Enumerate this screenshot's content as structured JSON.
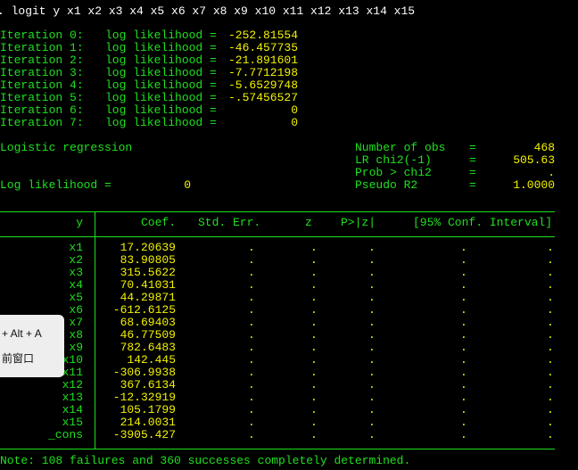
{
  "command": ". logit y x1 x2 x3 x4 x5 x6 x7 x8 x9 x10 x11 x12 x13 x14 x15",
  "iterations": [
    {
      "label": "Iteration 0:",
      "text": "log likelihood =",
      "value": "-252.81554"
    },
    {
      "label": "Iteration 1:",
      "text": "log likelihood =",
      "value": "-46.457735"
    },
    {
      "label": "Iteration 2:",
      "text": "log likelihood =",
      "value": "-21.891601"
    },
    {
      "label": "Iteration 3:",
      "text": "log likelihood =",
      "value": "-7.7712198"
    },
    {
      "label": "Iteration 4:",
      "text": "log likelihood =",
      "value": "-5.6529748"
    },
    {
      "label": "Iteration 5:",
      "text": "log likelihood =",
      "value": "-.57456527"
    },
    {
      "label": "Iteration 6:",
      "text": "log likelihood =",
      "value": "0"
    },
    {
      "label": "Iteration 7:",
      "text": "log likelihood =",
      "value": "0"
    }
  ],
  "model_title": "Logistic regression",
  "log_likelihood": {
    "label": "Log likelihood =",
    "value": "0"
  },
  "stats": [
    {
      "label": "Number of obs",
      "eq": "=",
      "value": "468"
    },
    {
      "label": "LR chi2(-1)",
      "eq": "=",
      "value": "505.63"
    },
    {
      "label": "Prob > chi2",
      "eq": "=",
      "value": "."
    },
    {
      "label": "Pseudo R2",
      "eq": "=",
      "value": "1.0000"
    }
  ],
  "table": {
    "headers": {
      "var": "y",
      "coef": "Coef.",
      "se": "Std. Err.",
      "z": "z",
      "p": "P>|z|",
      "ci": "[95% Conf. Interval]"
    },
    "rows": [
      {
        "var": "x1",
        "coef": "17.20639",
        "se": ".",
        "z": ".",
        "p": ".",
        "lo": ".",
        "hi": "."
      },
      {
        "var": "x2",
        "coef": "83.90805",
        "se": ".",
        "z": ".",
        "p": ".",
        "lo": ".",
        "hi": "."
      },
      {
        "var": "x3",
        "coef": "315.5622",
        "se": ".",
        "z": ".",
        "p": ".",
        "lo": ".",
        "hi": "."
      },
      {
        "var": "x4",
        "coef": "70.41031",
        "se": ".",
        "z": ".",
        "p": ".",
        "lo": ".",
        "hi": "."
      },
      {
        "var": "x5",
        "coef": "44.29871",
        "se": ".",
        "z": ".",
        "p": ".",
        "lo": ".",
        "hi": "."
      },
      {
        "var": "x6",
        "coef": "-612.6125",
        "se": ".",
        "z": ".",
        "p": ".",
        "lo": ".",
        "hi": "."
      },
      {
        "var": "x7",
        "coef": "68.69403",
        "se": ".",
        "z": ".",
        "p": ".",
        "lo": ".",
        "hi": "."
      },
      {
        "var": "x8",
        "coef": "46.77509",
        "se": ".",
        "z": ".",
        "p": ".",
        "lo": ".",
        "hi": "."
      },
      {
        "var": "x9",
        "coef": "782.6483",
        "se": ".",
        "z": ".",
        "p": ".",
        "lo": ".",
        "hi": "."
      },
      {
        "var": "x10",
        "coef": "142.445",
        "se": ".",
        "z": ".",
        "p": ".",
        "lo": ".",
        "hi": "."
      },
      {
        "var": "x11",
        "coef": "-306.9938",
        "se": ".",
        "z": ".",
        "p": ".",
        "lo": ".",
        "hi": "."
      },
      {
        "var": "x12",
        "coef": "367.6134",
        "se": ".",
        "z": ".",
        "p": ".",
        "lo": ".",
        "hi": "."
      },
      {
        "var": "x13",
        "coef": "-12.32919",
        "se": ".",
        "z": ".",
        "p": ".",
        "lo": ".",
        "hi": "."
      },
      {
        "var": "x14",
        "coef": "105.1799",
        "se": ".",
        "z": ".",
        "p": ".",
        "lo": ".",
        "hi": "."
      },
      {
        "var": "x15",
        "coef": "214.0031",
        "se": ".",
        "z": ".",
        "p": ".",
        "lo": ".",
        "hi": "."
      },
      {
        "var": "_cons",
        "coef": "-3905.427",
        "se": ".",
        "z": ".",
        "p": ".",
        "lo": ".",
        "hi": "."
      }
    ]
  },
  "note": "Note: 108 failures and 360 successes completely determined.",
  "popup": {
    "line1": "+ Alt + A",
    "line2": "前窗口"
  }
}
